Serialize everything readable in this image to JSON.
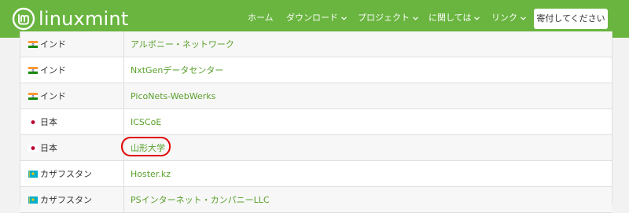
{
  "brand": {
    "name": "linuxmint"
  },
  "nav": {
    "home": "ホーム",
    "download": "ダウンロード",
    "project": "プロジェクト",
    "about": "に関しては",
    "links": "リンク",
    "donate": "寄付してください"
  },
  "mirrors": [
    {
      "country": "インド",
      "flag": "india-flag",
      "name": "アルボニー・ネットワーク"
    },
    {
      "country": "インド",
      "flag": "india-flag",
      "name": "NxtGenデータセンター"
    },
    {
      "country": "インド",
      "flag": "india-flag",
      "name": "PicoNets-WebWerks"
    },
    {
      "country": "日本",
      "flag": "japan-flag",
      "name": "ICSCoE"
    },
    {
      "country": "日本",
      "flag": "japan-flag",
      "name": "山形大学"
    },
    {
      "country": "カザフスタン",
      "flag": "kazakhstan-flag",
      "name": "Hoster.kz"
    },
    {
      "country": "カザフスタン",
      "flag": "kazakhstan-flag",
      "name": "PSインターネット・カンパニーLLC"
    }
  ],
  "colors": {
    "brand_green": "#69b53f",
    "link_green": "#5aa02c",
    "highlight_red": "#e00000"
  }
}
